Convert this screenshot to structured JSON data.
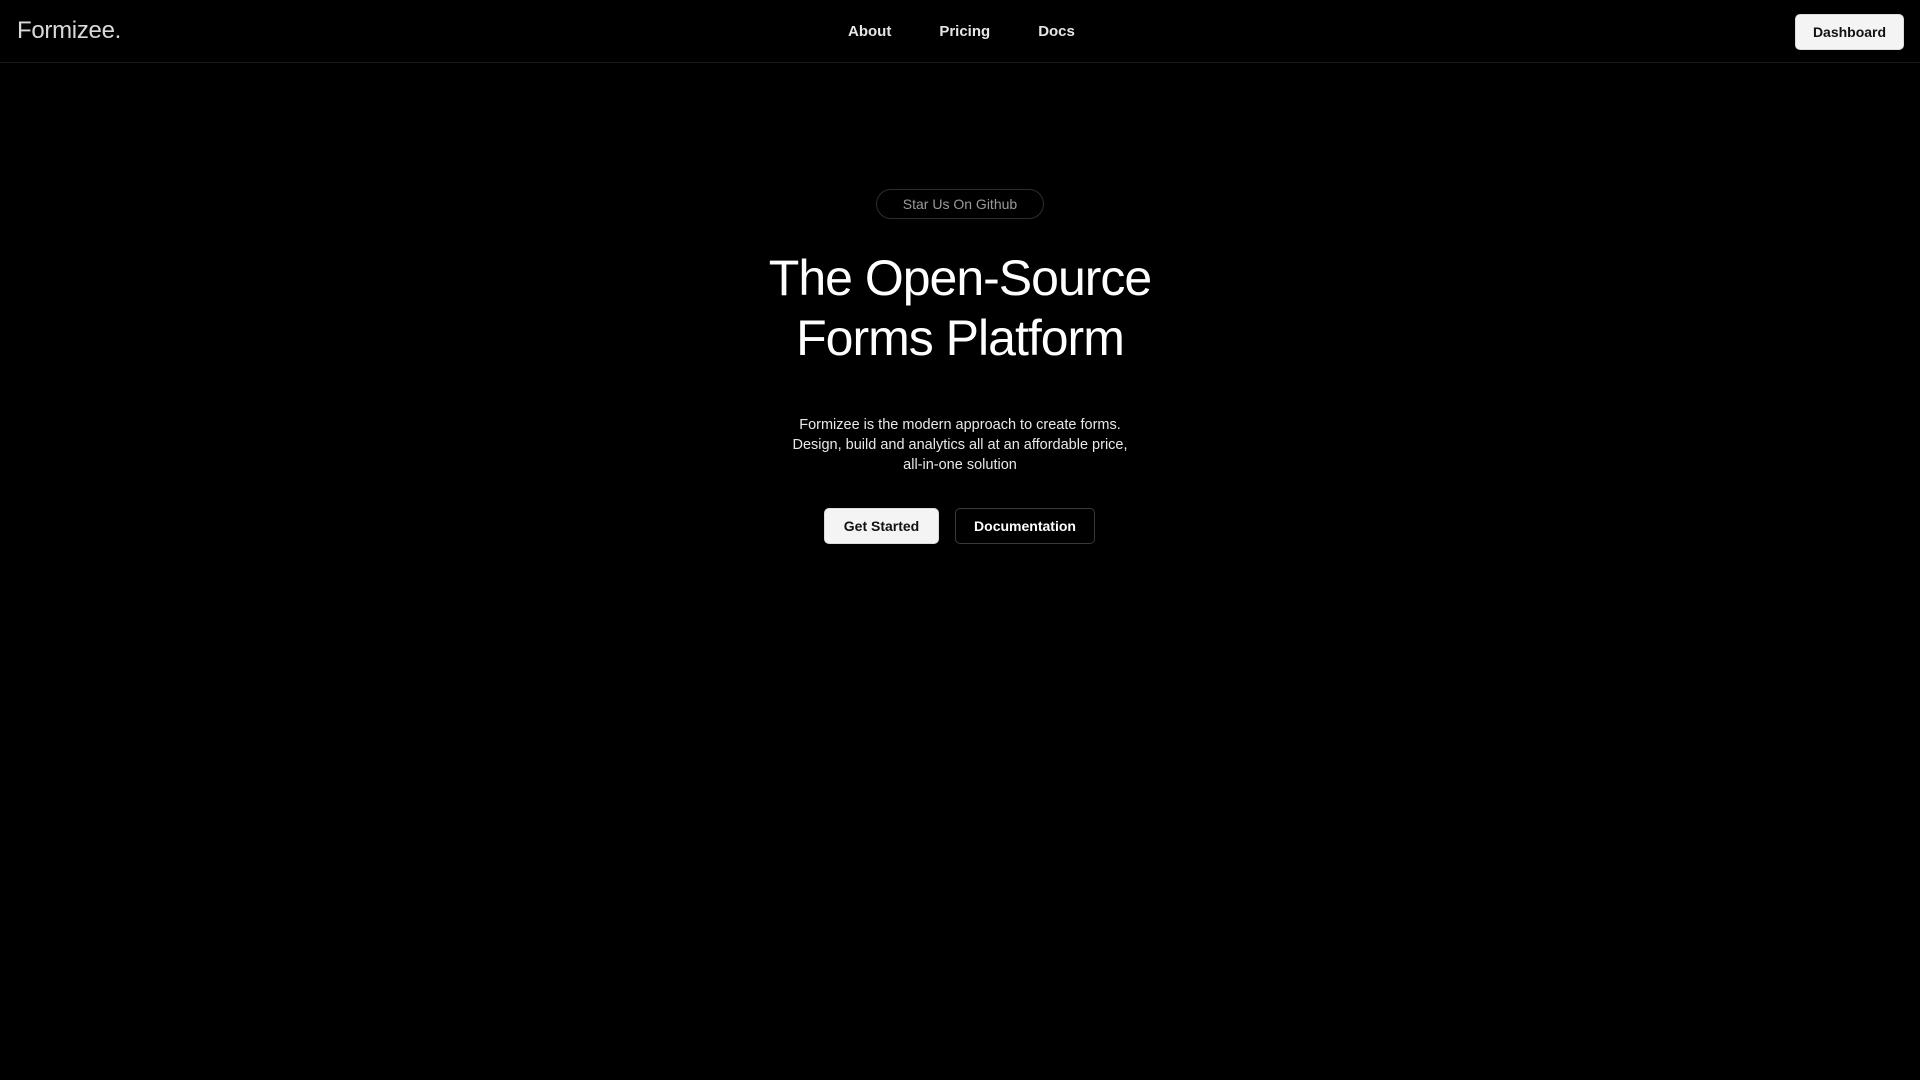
{
  "header": {
    "logo": "Formizee.",
    "nav": {
      "about": "About",
      "pricing": "Pricing",
      "docs": "Docs"
    },
    "dashboard_label": "Dashboard"
  },
  "hero": {
    "github_pill": "Star Us On Github",
    "title_line1": "The Open-Source",
    "title_line2": "Forms Platform",
    "subtitle_line1": "Formizee is the modern approach to create forms.",
    "subtitle_line2": "Design, build and analytics all at an affordable price,",
    "subtitle_line3": "all-in-one solution",
    "cta_primary": "Get Started",
    "cta_secondary": "Documentation"
  },
  "colors": {
    "background": "#000000",
    "text": "#ffffff",
    "muted": "#9a9a9a",
    "button_light": "#f4f4f4"
  }
}
